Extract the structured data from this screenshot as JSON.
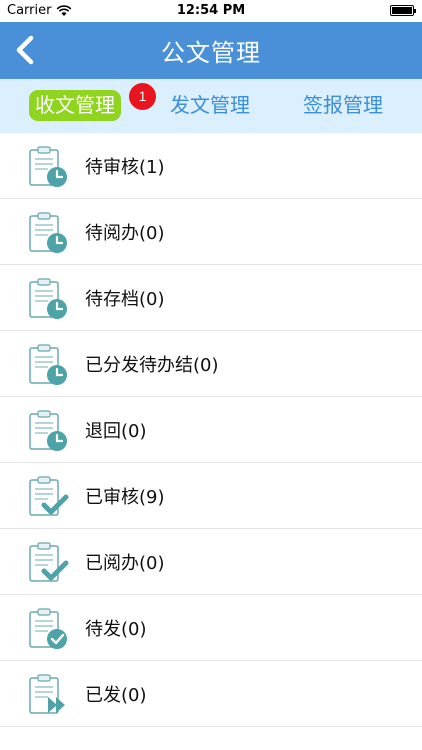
{
  "status_bar": {
    "carrier": "Carrier",
    "time": "12:54 PM"
  },
  "nav": {
    "title": "公文管理"
  },
  "tabs": [
    {
      "label": "收文管理",
      "active": true,
      "badge": "1"
    },
    {
      "label": "发文管理",
      "active": false
    },
    {
      "label": "签报管理",
      "active": false
    }
  ],
  "items": [
    {
      "label": "待审核(1)",
      "icon": "clipboard-clock-icon"
    },
    {
      "label": "待阅办(0)",
      "icon": "clipboard-clock-icon"
    },
    {
      "label": "待存档(0)",
      "icon": "clipboard-clock-icon"
    },
    {
      "label": "已分发待办结(0)",
      "icon": "clipboard-clock-icon"
    },
    {
      "label": "退回(0)",
      "icon": "clipboard-clock-icon"
    },
    {
      "label": "已审核(9)",
      "icon": "clipboard-check-icon"
    },
    {
      "label": "已阅办(0)",
      "icon": "clipboard-check-icon"
    },
    {
      "label": "待发(0)",
      "icon": "clipboard-check-circle-icon"
    },
    {
      "label": "已发(0)",
      "icon": "clipboard-forward-icon"
    }
  ],
  "colors": {
    "nav_bg": "#4a90d9",
    "tab_bar_bg": "#dcefff",
    "tab_active_bg": "#8fd41e",
    "tab_text": "#3a8fd8",
    "badge_bg": "#e8141e",
    "icon_teal": "#4da3a8"
  }
}
